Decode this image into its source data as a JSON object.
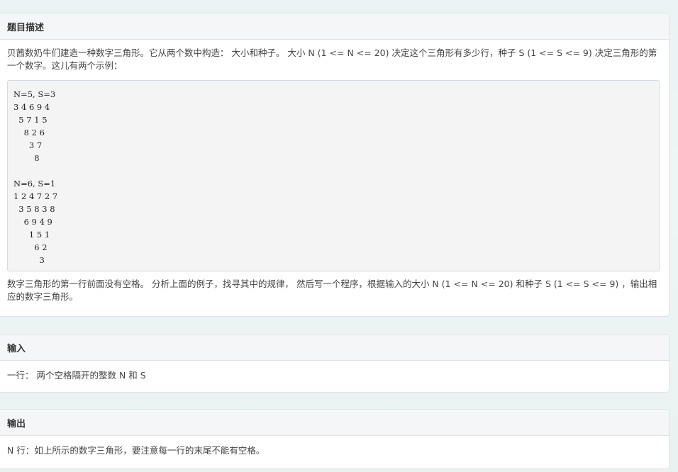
{
  "description": {
    "title": "题目描述",
    "intro": "贝茜数奶牛们建造一种数字三角形。它从两个数中构造： 大小和种子。 大小 N (1 <= N <= 20) 决定这个三角形有多少行，种子 S (1 <= S <= 9) 决定三角形的第一个数字。这儿有两个示例：",
    "code_lines": [
      "N=5, S=3",
      "3 4 6 9 4",
      "  5 7 1 5",
      "    8 2 6",
      "      3 7",
      "        8",
      "",
      "N=6, S=1",
      "1 2 4 7 2 7",
      "  3 5 8 3 8",
      "    6 9 4 9",
      "      1 5 1",
      "        6 2",
      "          3"
    ],
    "outro": "数字三角形的第一行前面没有空格。 分析上面的例子，找寻其中的规律， 然后写一个程序，根据输入的大小 N (1 <= N <= 20) 和种子 S (1 <= S <= 9) ，输出相应的数字三角形。"
  },
  "input": {
    "title": "输入",
    "text": "一行： 两个空格隔开的整数 N 和 S"
  },
  "output": {
    "title": "输出",
    "text": "N 行：如上所示的数字三角形，要注意每一行的末尾不能有空格。"
  }
}
